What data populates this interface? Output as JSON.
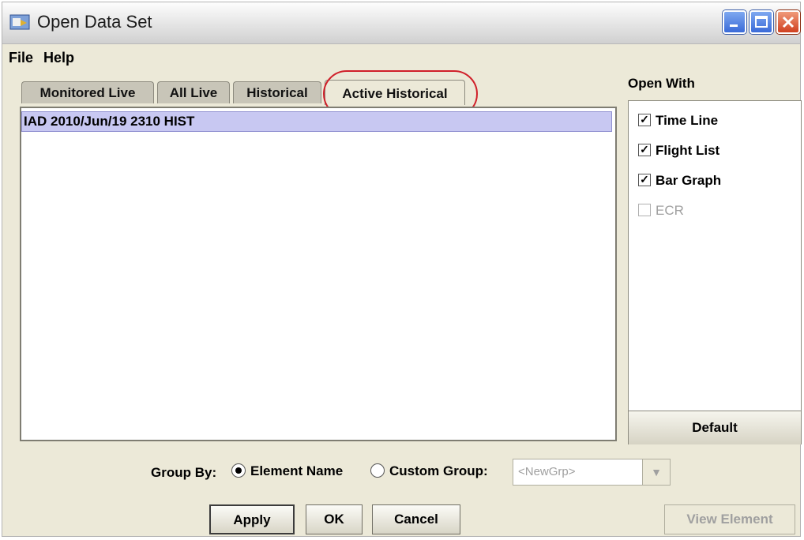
{
  "window": {
    "title": "Open Data Set"
  },
  "menu": {
    "file": "File",
    "help": "Help"
  },
  "tabs": [
    {
      "label": "Monitored Live",
      "selected": false
    },
    {
      "label": "All Live",
      "selected": false
    },
    {
      "label": "Historical",
      "selected": false
    },
    {
      "label": "Active Historical",
      "selected": true
    }
  ],
  "list": {
    "items": [
      "IAD 2010/Jun/19 2310 HIST"
    ]
  },
  "open_with": {
    "label": "Open With",
    "options": [
      {
        "label": "Time Line",
        "checked": true,
        "enabled": true
      },
      {
        "label": "Flight List",
        "checked": true,
        "enabled": true
      },
      {
        "label": "Bar Graph",
        "checked": true,
        "enabled": true
      },
      {
        "label": "ECR",
        "checked": false,
        "enabled": false
      }
    ],
    "default_button": "Default"
  },
  "group_by": {
    "label": "Group By:",
    "options": [
      {
        "label": "Element Name",
        "selected": true
      },
      {
        "label": "Custom Group:",
        "selected": false
      }
    ],
    "custom_group_placeholder": "<NewGrp>"
  },
  "buttons": {
    "apply": "Apply",
    "ok": "OK",
    "cancel": "Cancel",
    "view_element": "View Element"
  },
  "colors": {
    "highlight_ellipse": "#d0202a",
    "selected_row": "#c8c8f2",
    "panel_bg": "#ece9d8"
  }
}
